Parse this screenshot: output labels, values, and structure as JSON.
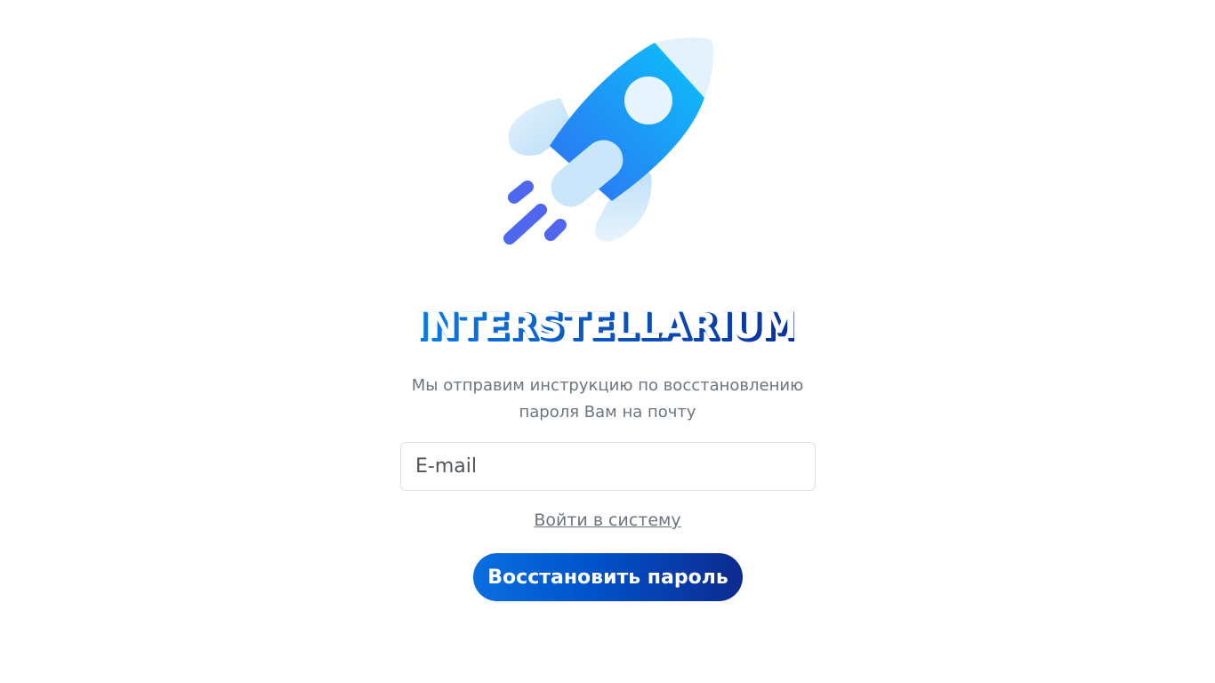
{
  "brand": {
    "name": "INTERSTELLARIUM",
    "colors": {
      "primary": "#0a6fe0",
      "dark": "#0d2a8f",
      "light": "#cbe6fb"
    }
  },
  "icons": {
    "logo_graphic": "rocket-icon"
  },
  "description": {
    "line1": "Мы отправим инструкцию по восстановлению",
    "line2": "пароля Вам на почту"
  },
  "form": {
    "email_placeholder": "E-mail",
    "email_value": ""
  },
  "links": {
    "login": "Войти в систему"
  },
  "buttons": {
    "restore": "Восстановить пароль"
  }
}
